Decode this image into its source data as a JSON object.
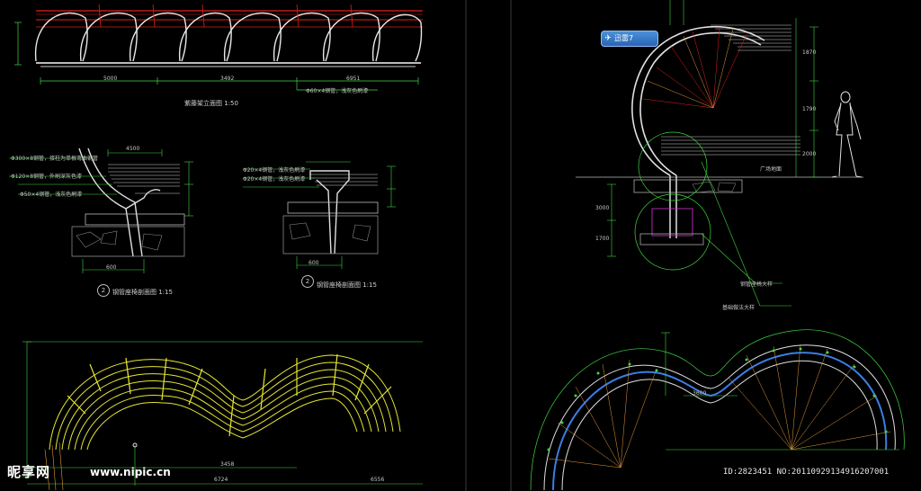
{
  "drawing": {
    "elevation_title": "紫藤架立面图 1:50",
    "section_title_1": "钢管座椅剖面图 1:15",
    "section_title_2": "钢管座椅剖面图 1:15",
    "section_1_number": "2",
    "section_2_number": "2",
    "detail_label_1": "钢管座椅大样",
    "detail_label_2": "基础做法大样",
    "ground_label": "广场地面",
    "dim_labels": [
      "5000",
      "3492",
      "6951",
      "4500",
      "600",
      "1500",
      "3000",
      "1790",
      "1870",
      "2000",
      "1700",
      "1200",
      "3600",
      "6724",
      "6556",
      "3458"
    ],
    "note_labels": [
      "Φ300×8钢管，接柱为单根弯曲钢管",
      "Φ120×8钢管，外刷深灰色漆",
      "Φ50×4钢管，浅灰色刷漆",
      "Φ20×4钢管，浅灰色刷漆",
      "Φ20×4钢管，浅灰色刷漆",
      "Φ60×4钢管，浅灰色刷漆"
    ]
  },
  "badge": {
    "icon": "plane-icon",
    "label": "迅雷7"
  },
  "watermark": {
    "logo": "昵享网",
    "url": "www.nipic.cn",
    "id_text": "ID:2823451 NO:20110929134916207001"
  },
  "colors": {
    "background": "#000000",
    "line_white": "#e0e0e0",
    "line_green": "#3fd83f",
    "line_red": "#e02020",
    "line_yellow": "#e6e633",
    "line_orange": "#e39a3b",
    "line_blue": "#3b7de3",
    "line_magenta": "#d633d6"
  }
}
